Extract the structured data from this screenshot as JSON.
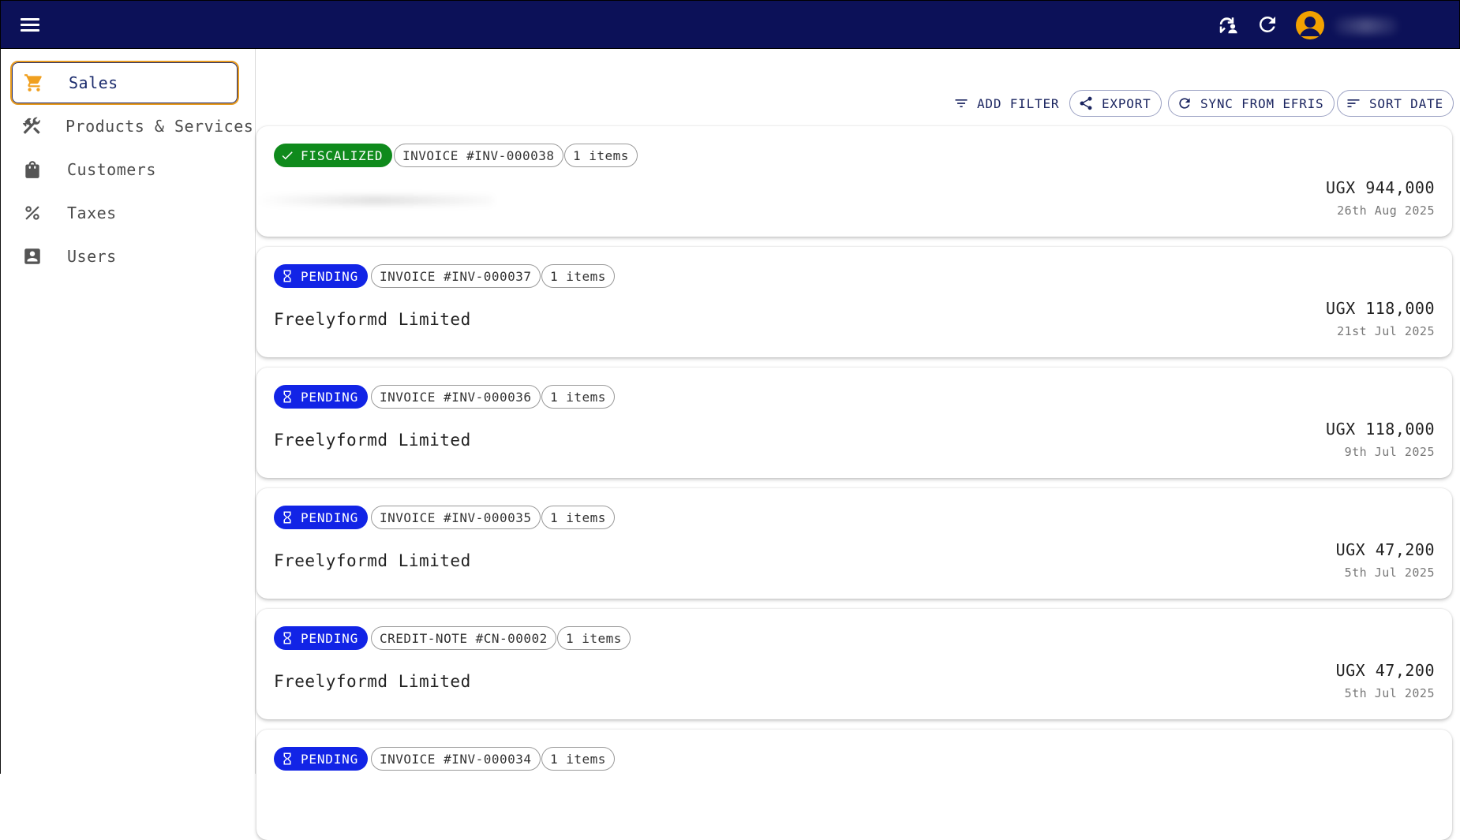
{
  "sidebar": {
    "items": [
      {
        "label": "Sales",
        "icon": "cart-icon",
        "active": true
      },
      {
        "label": "Products & Services",
        "icon": "tools-icon",
        "active": false
      },
      {
        "label": "Customers",
        "icon": "shopping-bag-icon",
        "active": false
      },
      {
        "label": "Taxes",
        "icon": "percent-icon",
        "active": false
      },
      {
        "label": "Users",
        "icon": "account-box-icon",
        "active": false
      }
    ]
  },
  "toolbar": {
    "add_filter": "ADD FILTER",
    "export": "EXPORT",
    "sync": "SYNC FROM EFRIS",
    "sort": "SORT DATE"
  },
  "colors": {
    "appbar": "#0c1158",
    "accent": "#e89b1e",
    "fiscalized": "#0f8a1c",
    "pending": "#1224e6"
  },
  "records": [
    {
      "status": "FISCALIZED",
      "document": "INVOICE #INV-000038",
      "items": "1 items",
      "customer": "",
      "amount": "UGX 944,000",
      "date": "26th Aug 2025"
    },
    {
      "status": "PENDING",
      "document": "INVOICE #INV-000037",
      "items": "1 items",
      "customer": "Freelyformd Limited",
      "amount": "UGX 118,000",
      "date": "21st Jul 2025"
    },
    {
      "status": "PENDING",
      "document": "INVOICE #INV-000036",
      "items": "1 items",
      "customer": "Freelyformd Limited",
      "amount": "UGX 118,000",
      "date": "9th Jul 2025"
    },
    {
      "status": "PENDING",
      "document": "INVOICE #INV-000035",
      "items": "1 items",
      "customer": "Freelyformd Limited",
      "amount": "UGX 47,200",
      "date": "5th Jul 2025"
    },
    {
      "status": "PENDING",
      "document": "CREDIT-NOTE #CN-00002",
      "items": "1 items",
      "customer": "Freelyformd Limited",
      "amount": "UGX 47,200",
      "date": "5th Jul 2025"
    },
    {
      "status": "PENDING",
      "document": "INVOICE #INV-000034",
      "items": "1 items",
      "customer": "",
      "amount": "",
      "date": ""
    }
  ]
}
